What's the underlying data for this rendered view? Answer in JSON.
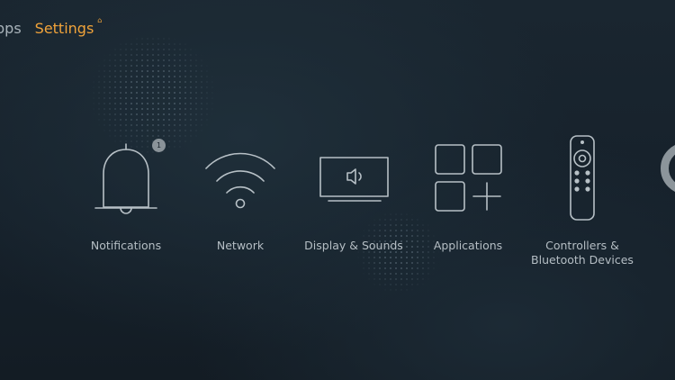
{
  "nav": {
    "prev_label": "pps",
    "active_label": "Settings",
    "active_marker": "⌂"
  },
  "tiles": [
    {
      "label": "Notifications",
      "icon": "bell-icon",
      "badge": "1"
    },
    {
      "label": "Network",
      "icon": "wifi-icon"
    },
    {
      "label": "Display & Sounds",
      "icon": "tv-speaker-icon"
    },
    {
      "label": "Applications",
      "icon": "apps-grid-icon"
    },
    {
      "label": "Controllers &\nBluetooth Devices",
      "icon": "remote-icon"
    }
  ],
  "colors": {
    "accent": "#f0a33a",
    "icon_stroke": "#b7c0c6",
    "text": "#b5bec4",
    "background": "#16212b"
  }
}
